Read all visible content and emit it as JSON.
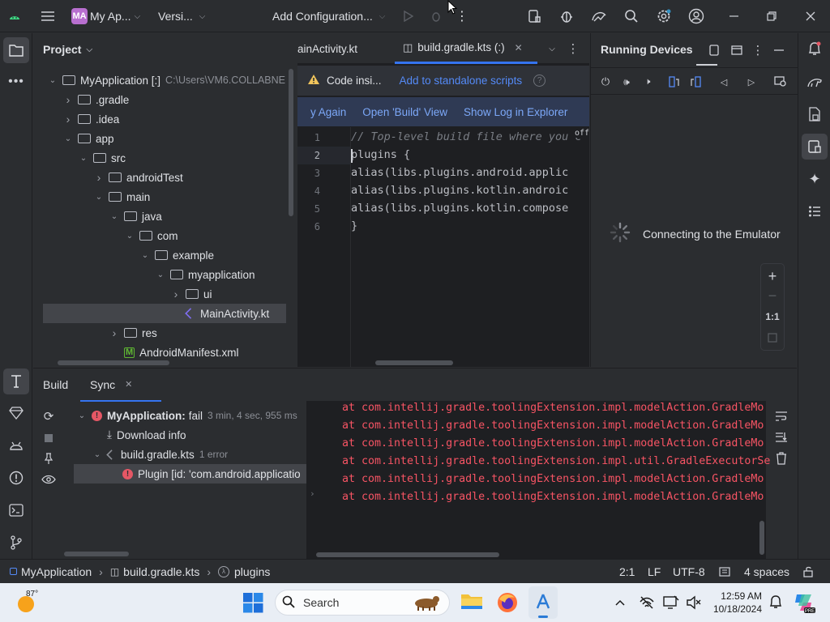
{
  "titlebar": {
    "project_badge": "MA",
    "project_name": "My Ap...",
    "vcs": "Versi...",
    "run_config": "Add Configuration...",
    "badge_color": "#b86fcf"
  },
  "project_panel": {
    "title": "Project",
    "tree": [
      {
        "label": "MyApplication [:]",
        "hint": "C:\\Users\\VM6.COLLABNE",
        "depth": 0,
        "state": "open",
        "kind": "module"
      },
      {
        "label": ".gradle",
        "depth": 1,
        "state": "closed",
        "kind": "folder"
      },
      {
        "label": ".idea",
        "depth": 1,
        "state": "closed",
        "kind": "folder"
      },
      {
        "label": "app",
        "depth": 1,
        "state": "open",
        "kind": "folder"
      },
      {
        "label": "src",
        "depth": 2,
        "state": "open",
        "kind": "folder"
      },
      {
        "label": "androidTest",
        "depth": 3,
        "state": "closed",
        "kind": "folder"
      },
      {
        "label": "main",
        "depth": 3,
        "state": "open",
        "kind": "folder"
      },
      {
        "label": "java",
        "depth": 4,
        "state": "open",
        "kind": "folder"
      },
      {
        "label": "com",
        "depth": 5,
        "state": "open",
        "kind": "folder"
      },
      {
        "label": "example",
        "depth": 6,
        "state": "open",
        "kind": "folder"
      },
      {
        "label": "myapplication",
        "depth": 7,
        "state": "open",
        "kind": "folder"
      },
      {
        "label": "ui",
        "depth": 8,
        "state": "closed",
        "kind": "folder"
      },
      {
        "label": "MainActivity.kt",
        "depth": 8,
        "state": "none",
        "kind": "kotlin",
        "selected": true
      },
      {
        "label": "res",
        "depth": 4,
        "state": "closed",
        "kind": "folder"
      },
      {
        "label": "AndroidManifest.xml",
        "depth": 4,
        "state": "none",
        "kind": "manifest"
      }
    ]
  },
  "editor": {
    "tabs": [
      {
        "label": "ainActivity.kt",
        "active": false
      },
      {
        "label": "build.gradle.kts (:)",
        "active": true
      }
    ],
    "banner_text": "Code insi...",
    "banner_link": "Add to standalone scripts",
    "build_links": [
      "y Again",
      "Open 'Build' View",
      "Show Log in Explorer"
    ],
    "lines": [
      {
        "n": "1",
        "text": "// Top-level build file where you c",
        "kind": "comment"
      },
      {
        "n": "2",
        "text": "plugins {",
        "kind": "code"
      },
      {
        "n": "3",
        "text": "    alias(libs.plugins.android.applic",
        "kind": "code"
      },
      {
        "n": "4",
        "text": "    alias(libs.plugins.kotlin.androic",
        "kind": "code"
      },
      {
        "n": "5",
        "text": "    alias(libs.plugins.kotlin.compose",
        "kind": "code"
      },
      {
        "n": "6",
        "text": "}",
        "kind": "code"
      }
    ],
    "off_hint": "off"
  },
  "running_devices": {
    "title": "Running Devices",
    "status": "Connecting to the Emulator",
    "zoom_reset": "1:1"
  },
  "build_panel": {
    "tabs": [
      "Build",
      "Sync"
    ],
    "tree": [
      {
        "label": "MyApplication:",
        "suffix": "fail",
        "hint": "3 min, 4 sec, 955 ms",
        "depth": 0,
        "kind": "error"
      },
      {
        "label": "Download info",
        "depth": 1,
        "kind": "download"
      },
      {
        "label": "build.gradle.kts",
        "hint": "1 error",
        "depth": 1,
        "kind": "file"
      },
      {
        "label": "Plugin [id: 'com.android.applicatio",
        "depth": 2,
        "kind": "error",
        "selected": true
      }
    ],
    "console": [
      "at com.intellij.gradle.toolingExtension.impl.modelAction.GradleMo",
      "at com.intellij.gradle.toolingExtension.impl.modelAction.GradleMo",
      "at com.intellij.gradle.toolingExtension.impl.modelAction.GradleMo",
      "at com.intellij.gradle.toolingExtension.impl.util.GradleExecutorSe",
      "at com.intellij.gradle.toolingExtension.impl.modelAction.GradleMo",
      "at com.intellij.gradle.toolingExtension.impl.modelAction.GradleMo"
    ]
  },
  "statusbar": {
    "crumbs": [
      "MyApplication",
      "build.gradle.kts",
      "plugins"
    ],
    "position": "2:1",
    "line_sep": "LF",
    "encoding": "UTF-8",
    "indent": "4 spaces"
  },
  "taskbar": {
    "weather": "87°",
    "search": "Search",
    "time": "12:59 AM",
    "date": "10/18/2024"
  }
}
